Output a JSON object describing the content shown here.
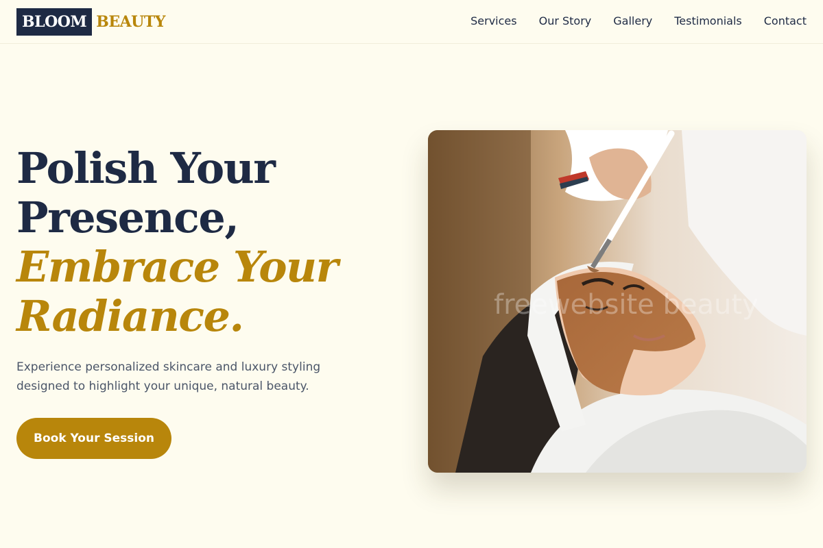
{
  "brand": {
    "name_dark": "BLOOM",
    "name_gold": "BEAUTY"
  },
  "nav": {
    "items": [
      {
        "label": "Services"
      },
      {
        "label": "Our Story"
      },
      {
        "label": "Gallery"
      },
      {
        "label": "Testimonials"
      },
      {
        "label": "Contact"
      }
    ]
  },
  "hero": {
    "title_line1": "Polish Your",
    "title_line2": "Presence,",
    "title_line3": "Embrace Your",
    "title_line4": "Radiance.",
    "subtitle": "Experience personalized skincare and luxury styling designed to highlight your unique, natural beauty.",
    "cta_label": "Book Your Session",
    "image_watermark": "freewebsite beauty"
  },
  "colors": {
    "background": "#fefcef",
    "navy": "#1e2a44",
    "gold": "#b8860b",
    "text_muted": "#4a5568"
  }
}
